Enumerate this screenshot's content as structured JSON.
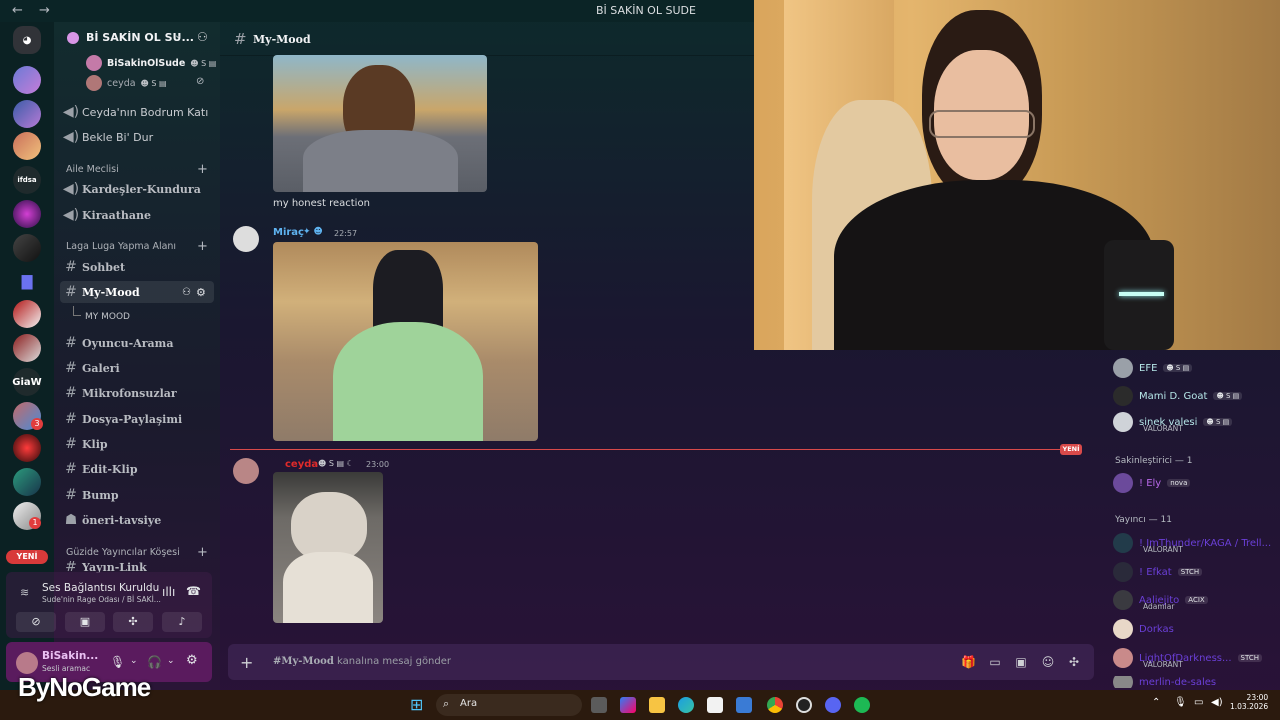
{
  "titlebar": {
    "nav": "← →",
    "title": "Bİ SAKİN OL SUDE"
  },
  "server": {
    "name": "Bİ SAKİN OL SU...",
    "voice_users": [
      {
        "name": "BiSakinOlSude",
        "tags": "☻ S ▤"
      },
      {
        "name": "ceyda",
        "tags": "☻ S ▤"
      }
    ],
    "voice_channels": [
      "Ceyda'nın Bodrum Katı",
      "Bekle Bi' Dur"
    ],
    "categories": [
      {
        "label": "Aile Meclisi",
        "channels": [
          "Kardeşler-Kundura",
          "Kiraathane"
        ]
      },
      {
        "label": "Laga Luga Yapma Alanı",
        "channels": [
          "Sohbet",
          "My-Mood",
          "Oyuncu-Arama",
          "Galeri",
          "Mikrofonsuzlar",
          "Dosya-Paylaşimi",
          "Klip",
          "Edit-Klip",
          "Bump",
          "öneri-tavsiye"
        ]
      },
      {
        "label": "Güzide Yayıncılar Köşesi",
        "channels": [
          "Yayın-Link"
        ]
      }
    ],
    "thread": "MY MOOD",
    "rail_text": "GiaW",
    "rail_badge_yeni": "YENİ",
    "rail_badges": [
      "3",
      "1"
    ]
  },
  "voice_panel": {
    "status": "Ses Bağlantısı Kuruldu",
    "room": "Sude'nin Rage Odası / Bİ SAKİ..."
  },
  "user_panel": {
    "name": "BiSakin...",
    "status": "Sesli aramac"
  },
  "chat": {
    "channel": "My-Mood",
    "messages": [
      {
        "caption": "my honest reaction"
      },
      {
        "author": "Miraç",
        "time": "22:57",
        "tags": "✦ ☻"
      },
      {
        "author": "ceyda",
        "time": "23:00",
        "tags": "☻ S ▤ ☾"
      }
    ],
    "new_label": "YENİ",
    "composer_prefix": "#My-Mood",
    "composer_suffix": " kanalına mesaj gönder"
  },
  "members": {
    "online": [
      {
        "name": "EFE",
        "tag": "☻ S ▤",
        "activity": ""
      },
      {
        "name": "Mami D. Goat",
        "tag": "☻ S ▤",
        "activity": ""
      },
      {
        "name": "sinek valesi",
        "tag": "☻ S ▤",
        "activity": "VALORANT"
      }
    ],
    "cat_sakin": "Sakinleştirici — 1",
    "sakin": [
      {
        "name": "! Ely",
        "tag": "nova"
      }
    ],
    "cat_yayinci": "Yayıncı — 11",
    "yayinci": [
      {
        "name": "! ImThunder/KAGA / Trell...",
        "tag": "",
        "activity": "VALORANT"
      },
      {
        "name": "! Efkat",
        "tag": "STCH",
        "activity": ""
      },
      {
        "name": "Aaliejito",
        "tag": "ACIX",
        "activity": "Adamlar"
      },
      {
        "name": "Dorkas",
        "tag": "",
        "activity": ""
      },
      {
        "name": "LightOfDarkness...",
        "tag": "STCH",
        "activity": "VALORANT"
      },
      {
        "name": "merlin-de-sales",
        "tag": "",
        "activity": ""
      }
    ]
  },
  "taskbar": {
    "search": "Ara",
    "time": "23:00",
    "date": "1.03.2026",
    "brand": "ByNoGame"
  }
}
